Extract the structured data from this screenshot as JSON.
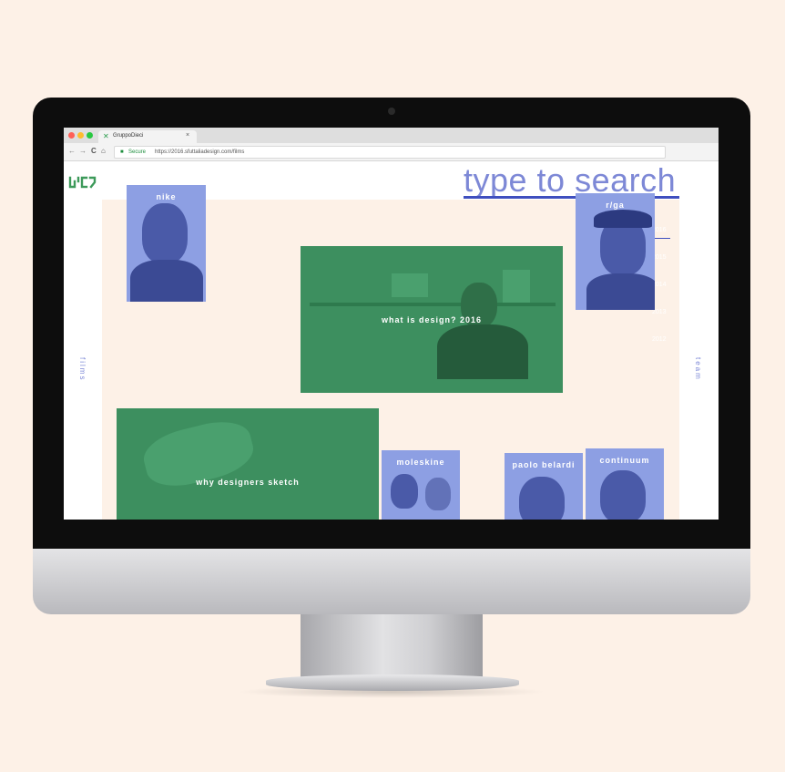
{
  "browser": {
    "tab_title": "GruppoDieci",
    "tab_close": "×",
    "nav_back": "←",
    "nav_forward": "→",
    "nav_reload": "C",
    "nav_home": "⌂",
    "security_label": "Secure",
    "url": "https://2016.sfuttaliadesign.com/films",
    "colors": {
      "close": "#ff5f57",
      "minimize": "#febc2e",
      "maximize": "#28c840"
    }
  },
  "site": {
    "search_text": "type to search",
    "left_nav": "films",
    "right_nav": "team",
    "years": [
      "2016",
      "2015",
      "2014",
      "2013",
      "2012"
    ],
    "cards": {
      "nike": "nike",
      "rga": "r/ga",
      "what_is_design": "what is design? 2016",
      "why_designers_sketch": "why designers sketch",
      "moleskine": "moleskine",
      "paolo_belardi": "paolo belardi",
      "continuum": "continuum"
    },
    "colors": {
      "accent": "#7d88d6",
      "green": "#3d8f5f",
      "blue_overlay": "#8d9fe3",
      "cream": "#fdf1e7"
    }
  }
}
